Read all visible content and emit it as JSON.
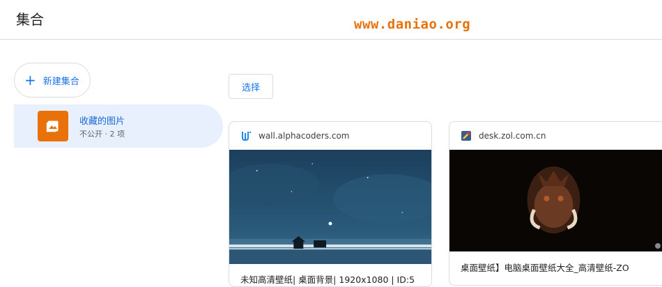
{
  "header": {
    "title": "集合",
    "watermark": "www.daniao.org"
  },
  "sidebar": {
    "new_collection_label": "新建集合",
    "collections": [
      {
        "name": "收藏的图片",
        "meta": "不公开 · 2 项",
        "thumb_icon": "photo-icon",
        "thumb_color": "#e8710a"
      }
    ]
  },
  "main": {
    "select_label": "选择",
    "cards": [
      {
        "source": "wall.alphacoders.com",
        "favicon": "alphacoders-icon",
        "caption": "未知高清壁纸| 桌面背景| 1920x1080 | ID:5"
      },
      {
        "source": "desk.zol.com.cn",
        "favicon": "zol-icon",
        "caption": "桌面壁纸】电脑桌面壁纸大全_高清壁纸-ZO"
      }
    ]
  },
  "colors": {
    "accent": "#1a73e8",
    "selected_bg": "#e8f0fe",
    "watermark": "#e8710a"
  }
}
